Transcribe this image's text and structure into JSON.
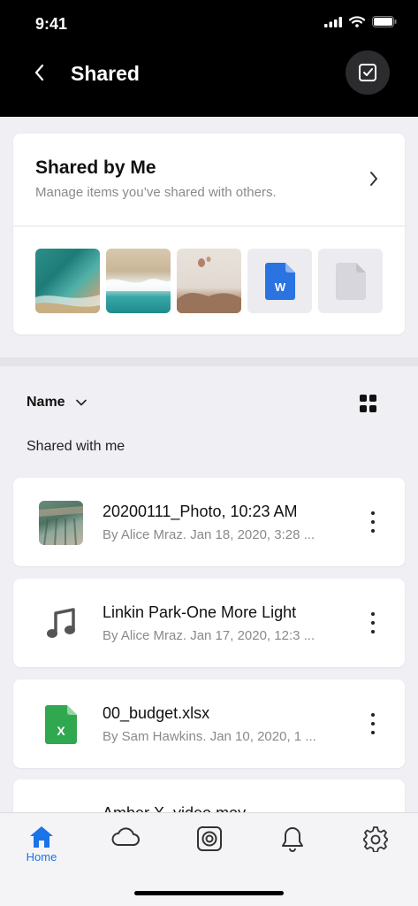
{
  "status_bar": {
    "time": "9:41"
  },
  "header": {
    "title": "Shared"
  },
  "shared_by_me": {
    "title": "Shared by Me",
    "subtitle": "Manage items you’ve shared with others.",
    "thumbnails": [
      "ocean-photo",
      "wave-photo",
      "desert-balloon-photo",
      "word-document",
      "generic-document"
    ],
    "word_badge": "W"
  },
  "sort": {
    "label": "Name"
  },
  "section_label": "Shared with me",
  "files": [
    {
      "name": "20200111_Photo, 10:23 AM",
      "meta": "By Alice Mraz. Jan 18, 2020, 3:28 ...",
      "icon": "photo-thumbnail"
    },
    {
      "name": "Linkin Park-One More Light",
      "meta": "By Alice Mraz. Jan 17, 2020, 12:3 ...",
      "icon": "music-note-icon"
    },
    {
      "name": "00_budget.xlsx",
      "meta": "By Sam Hawkins. Jan 10, 2020, 1 ...",
      "icon": "excel-icon",
      "badge": "X"
    },
    {
      "name": "Amber X_video.mov",
      "meta": "",
      "icon": "video-icon"
    }
  ],
  "tabs": [
    {
      "label": "Home",
      "icon": "home-icon",
      "active": true
    },
    {
      "label": "",
      "icon": "cloud-icon"
    },
    {
      "label": "",
      "icon": "photos-icon"
    },
    {
      "label": "",
      "icon": "bell-icon"
    },
    {
      "label": "",
      "icon": "gear-icon"
    }
  ],
  "colors": {
    "accent": "#1a73e8",
    "excel": "#2fa84f",
    "word": "#2a73e0"
  }
}
